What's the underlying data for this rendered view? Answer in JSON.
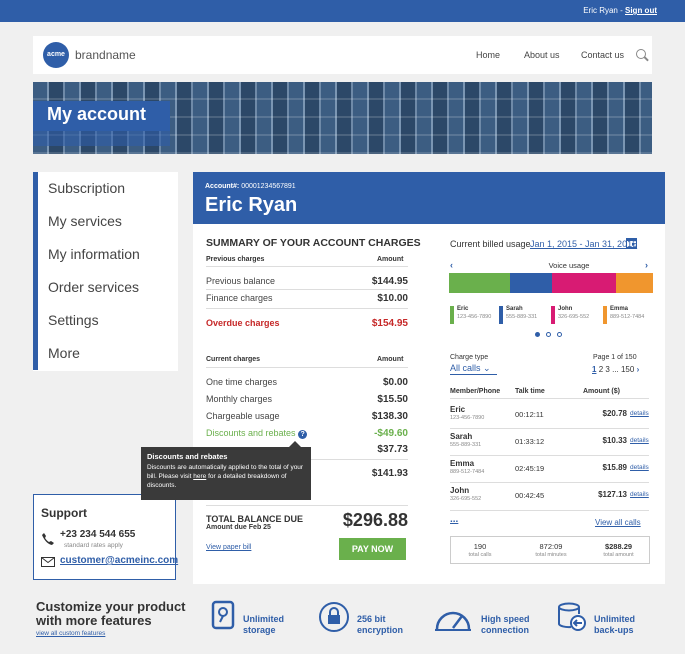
{
  "topbar": {
    "user": "Eric Ryan - ",
    "sign_out": "Sign out"
  },
  "header": {
    "logo": "acme",
    "brand": "brandname",
    "nav": [
      "Home",
      "About us",
      "Contact us"
    ]
  },
  "banner": {
    "title": "My account"
  },
  "sidebar": {
    "items": [
      "Subscription",
      "My services",
      "My information",
      "Order services",
      "Settings",
      "More"
    ]
  },
  "support": {
    "title": "Support",
    "phone": "+23 234 544 655",
    "phone_note": "standard rates apply",
    "email": "customer@acmeinc.com"
  },
  "account": {
    "label": "Account#:",
    "number": "00001234567891",
    "name": "Eric Ryan"
  },
  "summary": {
    "title": "SUMMARY OF YOUR ACCOUNT CHARGES",
    "prev_header": "Previous charges",
    "amount_header": "Amount",
    "prev_rows": [
      {
        "label": "Previous balance",
        "value": "$144.95"
      },
      {
        "label": "Finance charges",
        "value": "$10.00"
      }
    ],
    "overdue": {
      "label": "Overdue charges",
      "value": "$154.95"
    },
    "curr_header": "Current charges",
    "curr_rows": [
      {
        "label": "One time charges",
        "value": "$0.00"
      },
      {
        "label": "Monthly charges",
        "value": "$15.50"
      },
      {
        "label": "Chargeable usage",
        "value": "$138.30"
      }
    ],
    "discount": {
      "label": "Discounts and rebates",
      "value": "-$49.60"
    },
    "tax_value": "$37.73",
    "subtotal_value": "$141.93",
    "total_label": "TOTAL BALANCE DUE",
    "due_label": "Amount due Feb 25",
    "total_value": "$296.88",
    "paper_bill": "View paper bill",
    "pay_now": "PAY NOW"
  },
  "tooltip": {
    "title": "Discounts and rebates",
    "text1": "Discounts are automatically applied to the total of your bill. Please visit ",
    "link": "here",
    "text2": " for a detailed breakdown of  discounts."
  },
  "usage": {
    "label": "Current billed usage",
    "range": "Jan 1, 2015 - Jan 31, 2015",
    "voice": "Voice usage",
    "colors": [
      "#6ab04c",
      "#2f5ea8",
      "#d81b73",
      "#f0962e"
    ],
    "members": [
      {
        "name": "Eric",
        "phone": "123-456-7890"
      },
      {
        "name": "Sarah",
        "phone": "555-889-331"
      },
      {
        "name": "John",
        "phone": "326-695-552"
      },
      {
        "name": "Emma",
        "phone": "889-512-7484"
      }
    ],
    "charge_type": "Charge type",
    "charge_value": "All calls",
    "page_info": "Page 1 of 150",
    "pages": [
      "1",
      "2",
      "3",
      "...",
      "150"
    ],
    "col_member": "Member/Phone",
    "col_talk": "Talk time",
    "col_amount": "Amount ($)",
    "rows": [
      {
        "name": "Eric",
        "phone": "123-456-7890",
        "talk": "00:12:11",
        "amount": "$20.78",
        "details": "details"
      },
      {
        "name": "Sarah",
        "phone": "555-889-331",
        "talk": "01:33:12",
        "amount": "$10.33",
        "details": "details"
      },
      {
        "name": "Emma",
        "phone": "889-512-7484",
        "talk": "02:45:19",
        "amount": "$15.89",
        "details": "details"
      },
      {
        "name": "John",
        "phone": "326-695-552",
        "talk": "00:42:45",
        "amount": "$127.13",
        "details": "details"
      }
    ],
    "more": "...",
    "view_all": "View all calls",
    "totals": [
      {
        "value": "190",
        "label": "total calls"
      },
      {
        "value": "872:09",
        "label": "total minutes"
      },
      {
        "value": "$288.29",
        "label": "total amount"
      }
    ]
  },
  "features": {
    "title": "Customize your product with more features",
    "link": "view all custom features",
    "items": [
      {
        "line1": "Unlimited",
        "line2": "storage",
        "icon": "storage-icon"
      },
      {
        "line1": "256 bit",
        "line2": "encryption",
        "icon": "lock-icon"
      },
      {
        "line1": "High speed",
        "line2": "connection",
        "icon": "speedometer-icon"
      },
      {
        "line1": "Unlimited",
        "line2": "back-ups",
        "icon": "backup-icon"
      }
    ]
  }
}
